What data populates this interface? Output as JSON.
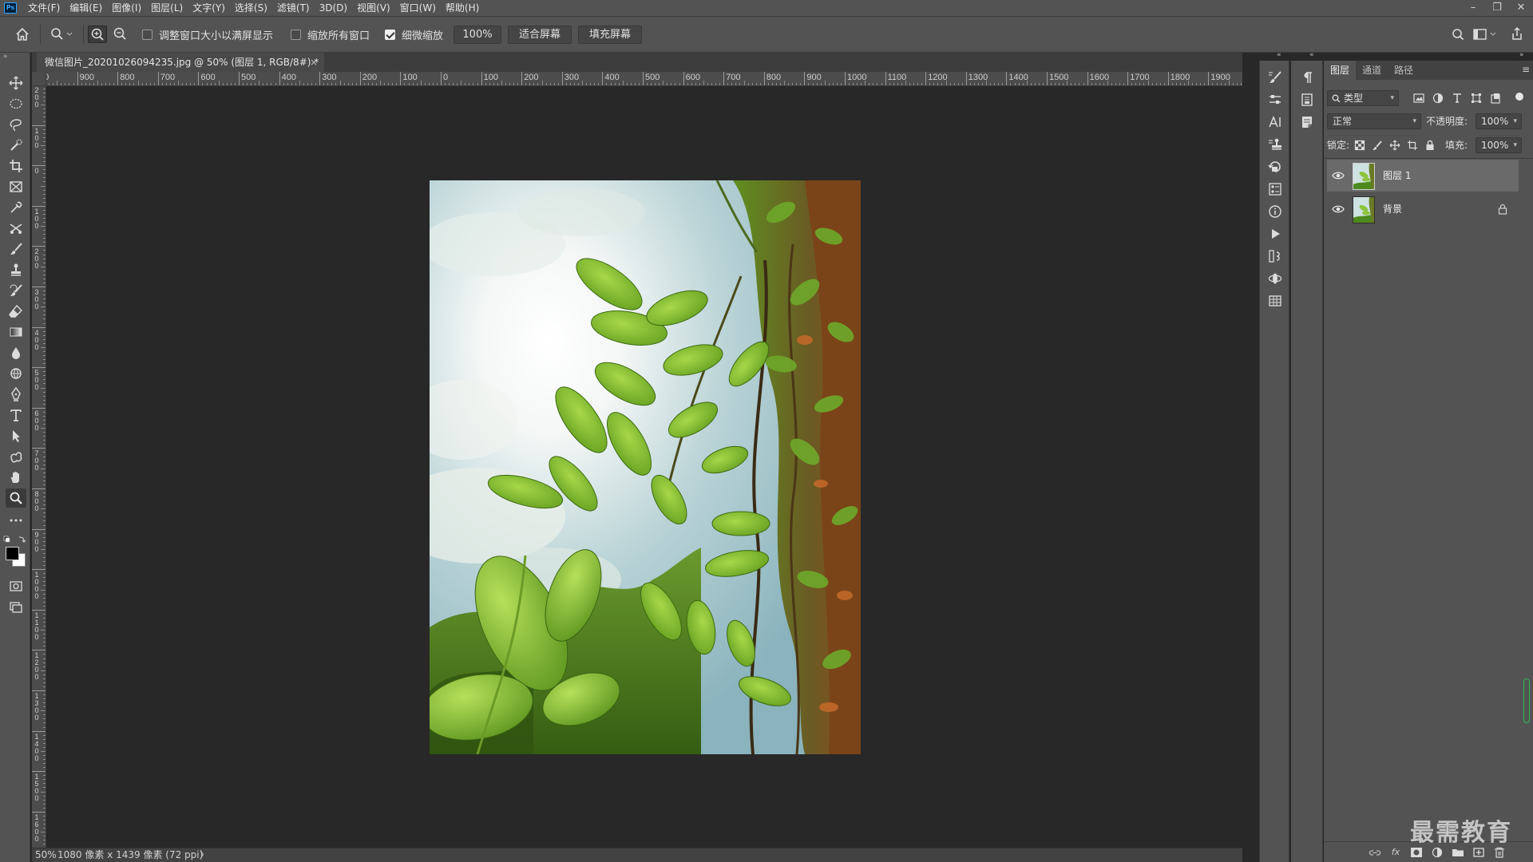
{
  "app": {
    "logo": "Ps",
    "menu": [
      "文件(F)",
      "编辑(E)",
      "图像(I)",
      "图层(L)",
      "文字(Y)",
      "选择(S)",
      "滤镜(T)",
      "3D(D)",
      "视图(V)",
      "窗口(W)",
      "帮助(H)"
    ],
    "window_controls": [
      "–",
      "❐",
      "✕"
    ]
  },
  "options": {
    "resize_windows_label": "调整窗口大小以满屏显示",
    "resize_windows_checked": false,
    "zoom_all_windows_label": "缩放所有窗口",
    "zoom_all_windows_checked": false,
    "scrubby_zoom_label": "细微缩放",
    "scrubby_zoom_checked": true,
    "zoom_100_label": "100%",
    "fit_screen_label": "适合屏幕",
    "fill_screen_label": "填充屏幕"
  },
  "toolbar": {
    "tools": [
      "move-tool",
      "marquee-tool",
      "lasso-tool",
      "quick-select-tool",
      "crop-tool",
      "frame-tool",
      "eyedropper-tool",
      "content-aware-move-tool",
      "brush-tool",
      "clone-stamp-tool",
      "history-brush-tool",
      "eraser-tool",
      "gradient-tool",
      "blur-tool",
      "dodge-tool",
      "pen-tool",
      "type-tool",
      "path-select-tool",
      "shape-tool",
      "hand-tool",
      "zoom-tool",
      "more-tools"
    ],
    "active_tool": "zoom-tool"
  },
  "document": {
    "tab_title": "微信图片_20201026094235.jpg @ 50% (图层 1, RGB/8#) *",
    "tab_close": "×",
    "ruler_top_labels": [
      "00",
      "900",
      "800",
      "700",
      "600",
      "500",
      "400",
      "300",
      "200",
      "100",
      "0",
      "100",
      "200",
      "300",
      "400",
      "500",
      "600",
      "700",
      "800",
      "900",
      "1000",
      "1100",
      "1200",
      "1300",
      "1400",
      "1500",
      "1600",
      "1700",
      "1800",
      "1900",
      "200"
    ],
    "ruler_left_labels": [
      "200",
      "100",
      "0",
      "100",
      "200",
      "300",
      "400",
      "500",
      "600",
      "700",
      "800",
      "900",
      "1000",
      "1100",
      "1200",
      "1300",
      "1400",
      "1500",
      "1600"
    ]
  },
  "status": {
    "zoom": "50%",
    "doc_info": "1080 像素 x 1439 像素 (72 ppi)",
    "arrow": "〉"
  },
  "layers_panel": {
    "tabs": [
      "图层",
      "通道",
      "路径"
    ],
    "active_tab": "图层",
    "menu_icon": "≡",
    "filter_label": "类型",
    "blend_mode": "正常",
    "opacity_label": "不透明度:",
    "opacity_value": "100%",
    "lock_label": "锁定:",
    "fill_label": "填充:",
    "fill_value": "100%",
    "layers": [
      {
        "name": "图层 1",
        "visible": true,
        "selected": true,
        "locked": false
      },
      {
        "name": "背景",
        "visible": true,
        "selected": false,
        "locked": true
      }
    ],
    "footer_buttons": [
      "link-layers",
      "fx",
      "add-mask",
      "adjustment-layer",
      "group",
      "new-layer",
      "delete-layer"
    ],
    "footer_fx": "fx"
  },
  "watermark": "最需教育",
  "colors": {
    "chrome": "#535353",
    "canvas_bg": "#282828",
    "accent_green": "#2bbf55",
    "ps_blue": "#31a8ff"
  }
}
